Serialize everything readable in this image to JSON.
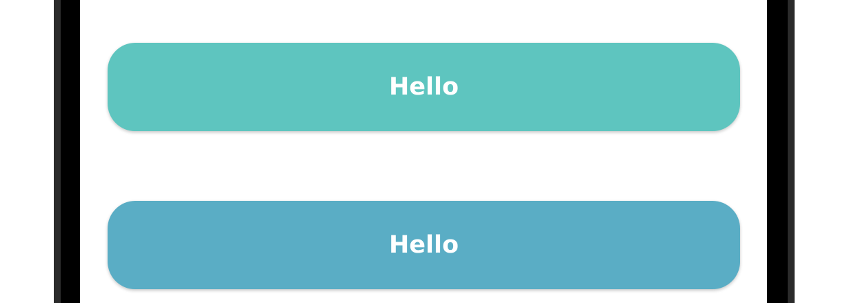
{
  "buttons": [
    {
      "label": "Hello",
      "color": "#5ec5bf"
    },
    {
      "label": "Hello",
      "color": "#5aadc5"
    }
  ]
}
